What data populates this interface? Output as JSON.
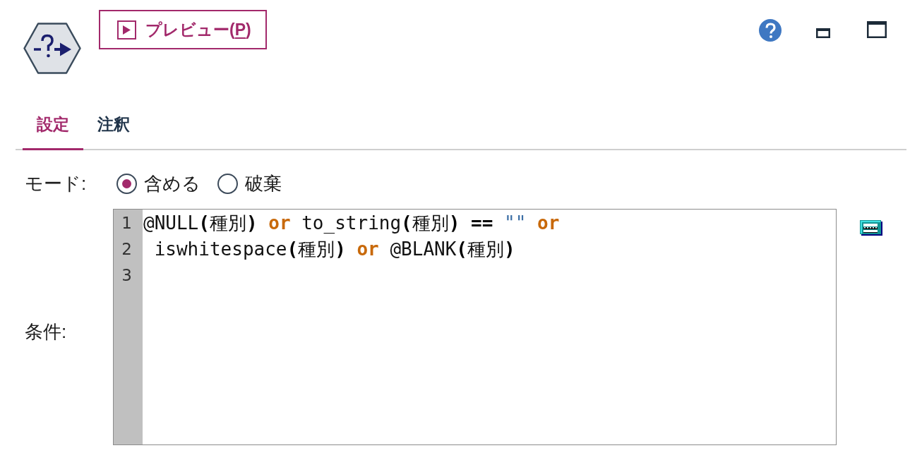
{
  "toolbar": {
    "preview_button": {
      "label_parts": [
        {
          "text": "プレビュー(",
          "underline": false
        },
        {
          "text": "P",
          "underline": true
        },
        {
          "text": ")",
          "underline": false
        }
      ]
    }
  },
  "tabs": [
    {
      "label": "設定",
      "selected": true
    },
    {
      "label": "注釈",
      "selected": false
    }
  ],
  "mode": {
    "label": "モード:",
    "options": [
      {
        "label": "含める",
        "selected": true
      },
      {
        "label": "破棄",
        "selected": false
      }
    ]
  },
  "condition": {
    "label": "条件:",
    "lines": [
      {
        "number": "1",
        "tokens": [
          {
            "kind": "plain",
            "text": "@NULL"
          },
          {
            "kind": "bold",
            "text": "("
          },
          {
            "kind": "plain",
            "text": "種別"
          },
          {
            "kind": "bold",
            "text": ") "
          },
          {
            "kind": "keyword",
            "text": "or"
          },
          {
            "kind": "plain",
            "text": " to_string"
          },
          {
            "kind": "bold",
            "text": "("
          },
          {
            "kind": "plain",
            "text": "種別"
          },
          {
            "kind": "bold",
            "text": ") == "
          },
          {
            "kind": "string",
            "text": "\"\" "
          },
          {
            "kind": "keyword",
            "text": "or"
          }
        ]
      },
      {
        "number": "2",
        "tokens": [
          {
            "kind": "plain",
            "text": " iswhitespace"
          },
          {
            "kind": "bold",
            "text": "("
          },
          {
            "kind": "plain",
            "text": "種別"
          },
          {
            "kind": "bold",
            "text": ") "
          },
          {
            "kind": "keyword",
            "text": "or"
          },
          {
            "kind": "plain",
            "text": " @BLANK"
          },
          {
            "kind": "bold",
            "text": "("
          },
          {
            "kind": "plain",
            "text": "種別"
          },
          {
            "kind": "bold",
            "text": ")"
          }
        ]
      },
      {
        "number": "3"
      }
    ]
  }
}
